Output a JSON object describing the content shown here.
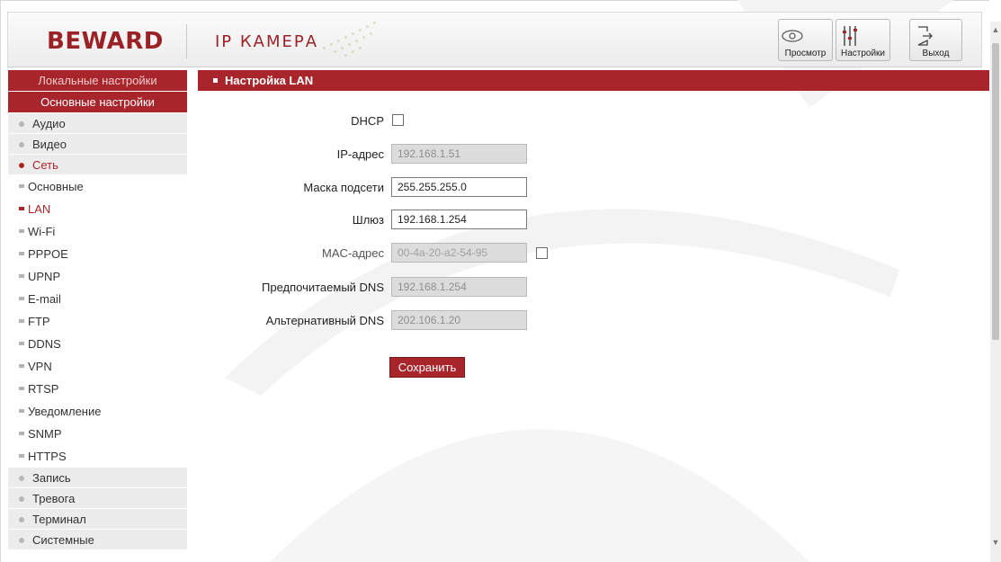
{
  "header": {
    "logo": "BEWARD",
    "product": "IP КАМЕРА",
    "buttons": {
      "view": "Просмотр",
      "settings": "Настройки",
      "exit": "Выход"
    }
  },
  "sidebar": {
    "local": "Локальные настройки",
    "basic": "Основные настройки",
    "items_top": [
      "Аудио",
      "Видео",
      "Сеть"
    ],
    "sub": [
      "Основные",
      "LAN",
      "Wi-Fi",
      "PPPOE",
      "UPNP",
      "E-mail",
      "FTP",
      "DDNS",
      "VPN",
      "RTSP",
      "Уведомление",
      "SNMP",
      "HTTPS"
    ],
    "items_bottom": [
      "Запись",
      "Тревога",
      "Терминал",
      "Системные"
    ],
    "active_item": "Сеть",
    "active_sub": "LAN"
  },
  "panel": {
    "title": "Настройка LAN",
    "dhcp_label": "DHCP",
    "dhcp_checked": false,
    "ip_label": "IP-адрес",
    "ip_value": "192.168.1.51",
    "mask_label": "Маска подсети",
    "mask_value": "255.255.255.0",
    "gateway_label": "Шлюз",
    "gateway_value": "192.168.1.254",
    "mac_label": "MAC-адрес",
    "mac_value": "00-4a-20-a2-54-95",
    "dns1_label": "Предпочитаемый DNS",
    "dns1_value": "192.168.1.254",
    "dns2_label": "Альтернативный DNS",
    "dns2_value": "202.106.1.20",
    "save": "Сохранить"
  },
  "colors": {
    "accent": "#a8262b",
    "sidebar_bg": "#ececec"
  }
}
